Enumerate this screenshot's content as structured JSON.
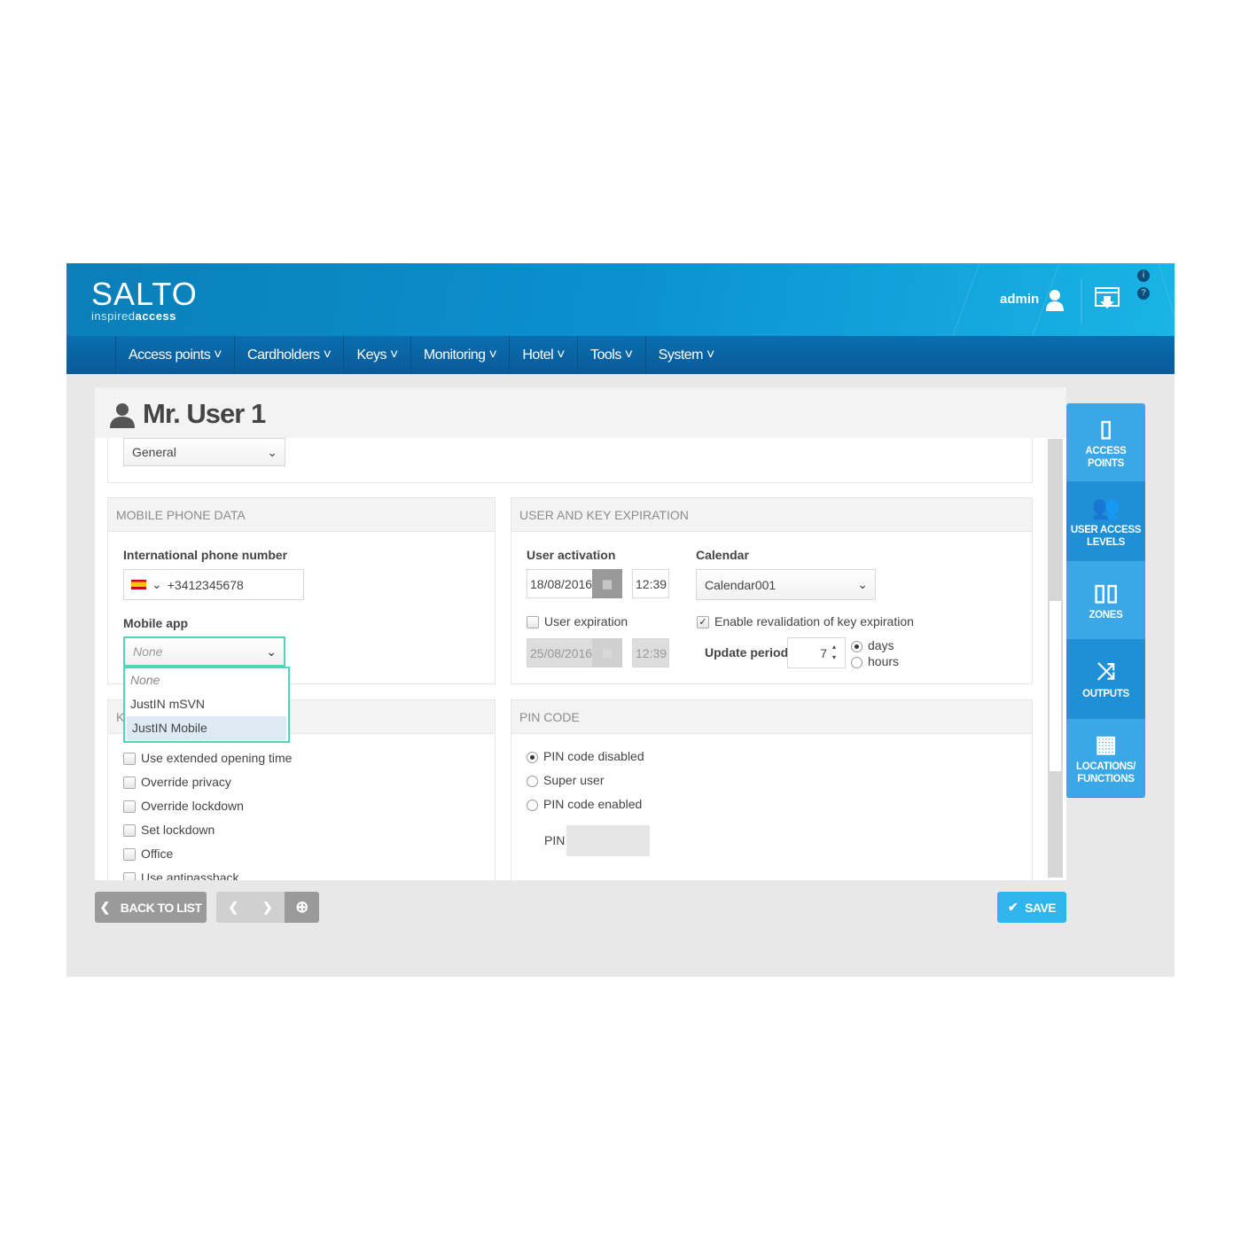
{
  "header": {
    "logo": "SALTO",
    "tagline_light": "inspired",
    "tagline_bold": "access",
    "user": "admin"
  },
  "nav": [
    "Access points",
    "Cardholders",
    "Keys",
    "Monitoring",
    "Hotel",
    "Tools",
    "System"
  ],
  "page": {
    "title": "Mr. User 1",
    "section_select": "General"
  },
  "mobile": {
    "heading": "MOBILE PHONE DATA",
    "phone_label": "International phone number",
    "phone_value": "+3412345678",
    "app_label": "Mobile app",
    "app_value": "None",
    "app_options": [
      "None",
      "JustIN mSVN",
      "JustIN Mobile"
    ],
    "highlighted_option": "JustIN Mobile"
  },
  "keys": {
    "heading_partial": "K",
    "options": [
      "Use extended opening time",
      "Override privacy",
      "Override lockdown",
      "Set lockdown",
      "Office",
      "Use antipassback"
    ]
  },
  "expiration": {
    "heading": "USER AND KEY EXPIRATION",
    "activation_label": "User activation",
    "activation_date": "18/08/2016",
    "activation_time": "12:39",
    "calendar_label": "Calendar",
    "calendar_value": "Calendar001",
    "expiration_label": "User expiration",
    "expiration_checked": false,
    "expiration_date": "25/08/2016",
    "expiration_time": "12:39",
    "revalidation_label": "Enable revalidation of key expiration",
    "revalidation_checked": true,
    "update_label": "Update period",
    "update_value": "7",
    "unit_days": "days",
    "unit_hours": "hours",
    "selected_unit": "days"
  },
  "pin": {
    "heading": "PIN CODE",
    "options": [
      "PIN code disabled",
      "Super user",
      "PIN code enabled"
    ],
    "selected": "PIN code disabled",
    "pin_label": "PIN",
    "pin_value": ""
  },
  "sidebar": [
    {
      "label": "ACCESS POINTS",
      "icon": "door-icon"
    },
    {
      "label": "USER ACCESS LEVELS",
      "icon": "users-icon"
    },
    {
      "label": "ZONES",
      "icon": "zones-icon"
    },
    {
      "label": "OUTPUTS",
      "icon": "outputs-icon"
    },
    {
      "label": "LOCATIONS/ FUNCTIONS",
      "icon": "locations-icon"
    }
  ],
  "footer": {
    "back": "BACK TO LIST",
    "save": "SAVE"
  },
  "colors": {
    "header": "#0b90cf",
    "nav": "#0a62a3",
    "tile": "#3aa8e6",
    "tile_alt": "#1f8fd6",
    "save": "#2fb4ee",
    "focus": "#4fd6b8"
  }
}
